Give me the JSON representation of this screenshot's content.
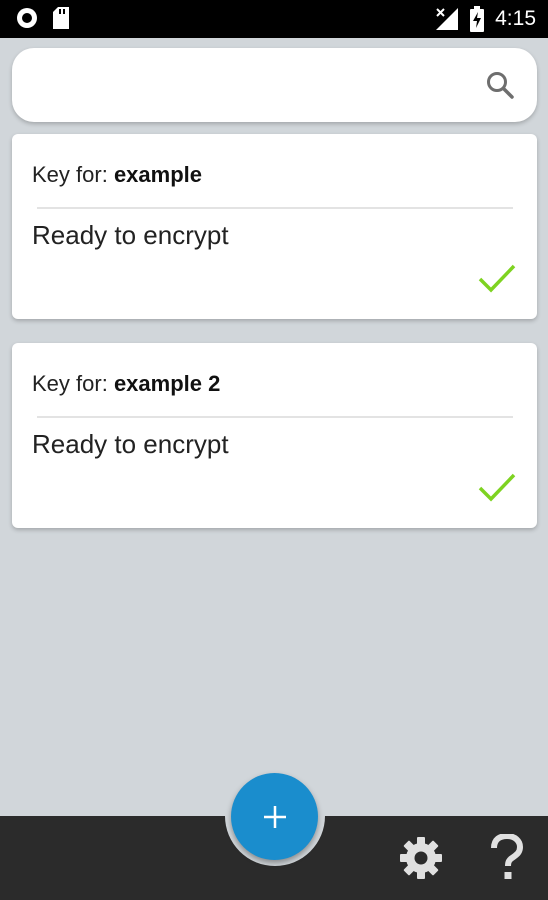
{
  "status_bar": {
    "time": "4:15",
    "icons": [
      "record-icon",
      "sd-card-icon",
      "no-signal-icon",
      "battery-charging-icon"
    ]
  },
  "search": {
    "value": "",
    "placeholder": "",
    "icon": "search-icon"
  },
  "keys": [
    {
      "label": "Key for:",
      "name": "example",
      "status": "Ready to encrypt",
      "status_icon": "check-icon",
      "status_color": "#7ed321"
    },
    {
      "label": "Key for:",
      "name": "example 2",
      "status": "Ready to encrypt",
      "status_icon": "check-icon",
      "status_color": "#7ed321"
    }
  ],
  "bottom_bar": {
    "add_label": "+",
    "settings_icon": "gear-icon",
    "help_icon": "question-mark-icon"
  },
  "colors": {
    "accent": "#1a8dcd",
    "background": "#d1d6da",
    "bottom_bar": "#2b2b2b"
  }
}
